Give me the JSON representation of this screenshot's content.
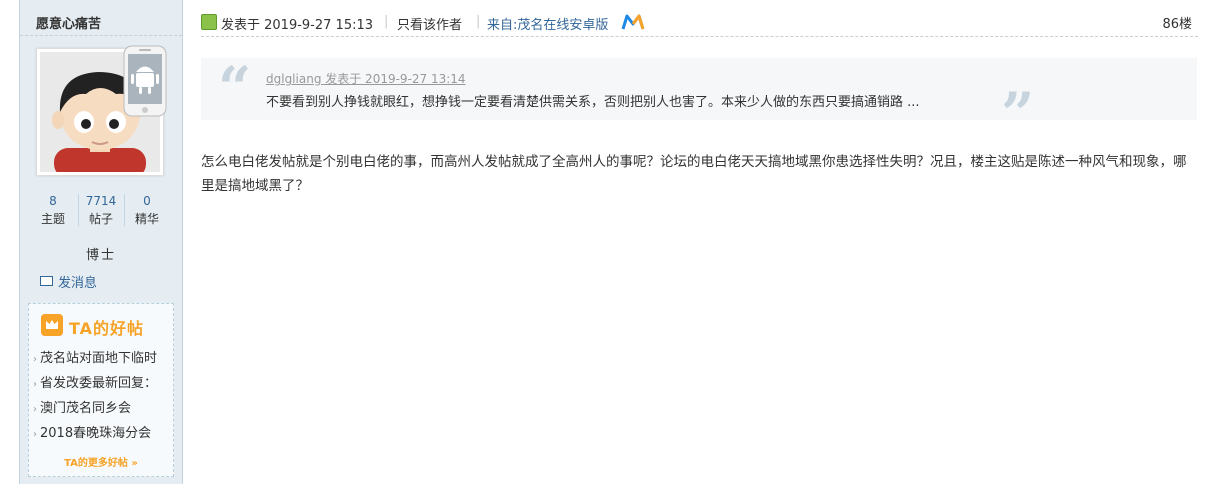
{
  "author": {
    "name": "愿意心痛苦",
    "stats": [
      {
        "value": "8",
        "label": "主题"
      },
      {
        "value": "7714",
        "label": "帖子"
      },
      {
        "value": "0",
        "label": "精华"
      }
    ],
    "rank": "博士",
    "message_label": "发消息"
  },
  "good_posts": {
    "title": "TA的好帖",
    "items": [
      "茂名站对面地下临时",
      "省发改委最新回复：",
      "澳门茂名同乡会",
      "2018春晚珠海分会"
    ],
    "more_label": "TA的更多好帖 »"
  },
  "post": {
    "posted_at": "发表于 2019-9-27 15:13",
    "only_author_label": "只看该作者",
    "from_label": "来自:茂名在线安卓版",
    "floor": "86楼",
    "quote": {
      "meta": "dglgliang 发表于 2019-9-27 13:14",
      "text": "不要看到别人挣钱就眼红，想挣钱一定要看清楚供需关系，否则把别人也害了。本来少人做的东西只要搞通销路 ..."
    },
    "body": "怎么电白佬发帖就是个别电白佬的事，而高州人发帖就成了全高州人的事呢？论坛的电白佬天天搞地域黑你患选择性失明？况且，楼主这贴是陈述一种风气和现象，哪里是搞地域黑了？"
  },
  "colors": {
    "sidebar_bg": "#e5edf2",
    "link": "#336699",
    "accent_orange": "#f6a328"
  }
}
